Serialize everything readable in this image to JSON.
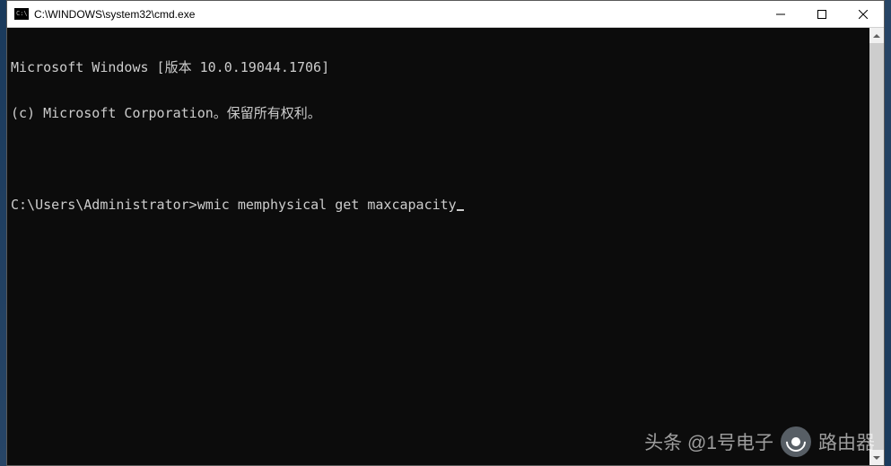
{
  "window": {
    "title": "C:\\WINDOWS\\system32\\cmd.exe",
    "icon_glyph": "C:\\"
  },
  "terminal": {
    "line1": "Microsoft Windows [版本 10.0.19044.1706]",
    "line2": "(c) Microsoft Corporation。保留所有权利。",
    "prompt": "C:\\Users\\Administrator>",
    "command": "wmic memphysical get maxcapacity"
  },
  "watermark": {
    "text": "头条 @1号电子",
    "badge": "路由器"
  }
}
